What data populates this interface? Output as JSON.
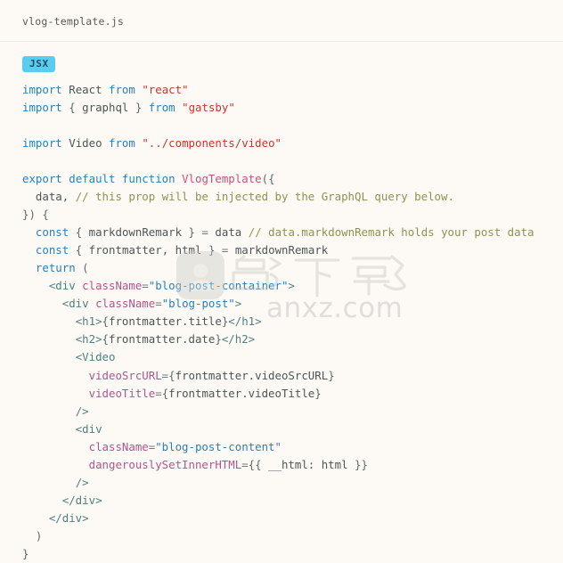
{
  "header": {
    "file_name": "vlog-template.js"
  },
  "code_block": {
    "language_badge": "JSX",
    "lines": [
      "import React from \"react\"",
      "import { graphql } from \"gatsby\"",
      "",
      "import Video from \"../components/video\"",
      "",
      "export default function VlogTemplate({",
      "  data, // this prop will be injected by the GraphQL query below.",
      "}) {",
      "  const { markdownRemark } = data // data.markdownRemark holds your post data",
      "  const { frontmatter, html } = markdownRemark",
      "  return (",
      "    <div className=\"blog-post-container\">",
      "      <div className=\"blog-post\">",
      "        <h1>{frontmatter.title}</h1>",
      "        <h2>{frontmatter.date}</h2>",
      "        <Video",
      "          videoSrcURL={frontmatter.videoSrcURL}",
      "          videoTitle={frontmatter.videoTitle}",
      "        />",
      "        <div",
      "          className=\"blog-post-content\"",
      "          dangerouslySetInnerHTML={{ __html: html }}",
      "        />",
      "      </div>",
      "    </div>",
      "  )",
      "}"
    ]
  },
  "watermark": {
    "site_text": "anxz.com",
    "logo_characters": "软下载"
  },
  "colors": {
    "page_background": "#fdfaf5",
    "badge_background": "#58cdf0",
    "badge_text": "#1f4f66",
    "keyword": "#2a7fb8",
    "string": "#c0392b",
    "comment": "#8d934f",
    "function_name": "#c2557a",
    "jsx_tag": "#4f7f7f",
    "jsx_attribute": "#b0558a",
    "default_text": "#4e5c5c",
    "divider": "#f0ece4",
    "watermark": "#b9b9b9"
  }
}
